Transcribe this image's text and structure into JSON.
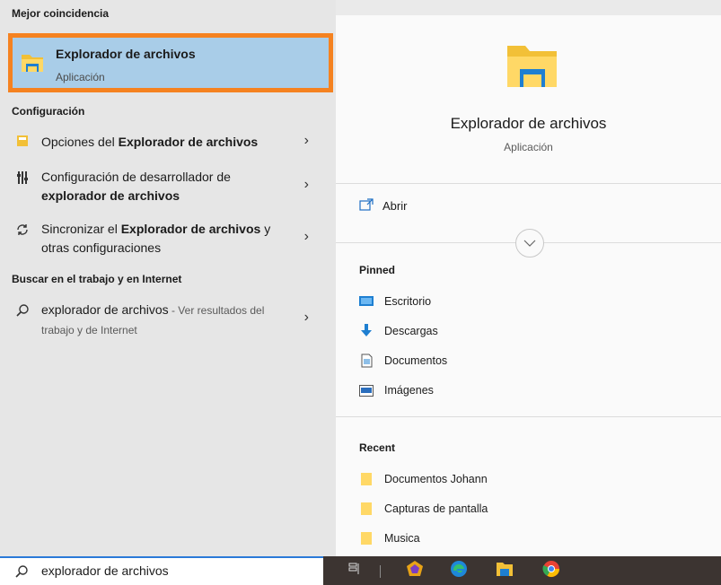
{
  "left": {
    "best_match_header": "Mejor coincidencia",
    "best_match": {
      "title": "Explorador de archivos",
      "subtitle": "Aplicación",
      "icon": "file-explorer-icon"
    },
    "settings_header": "Configuración",
    "settings": [
      {
        "icon": "settings-window-icon",
        "pre": "Opciones del ",
        "bold": "Explorador de archivos",
        "post": ""
      },
      {
        "icon": "developer-tools-icon",
        "pre": "Configuración de desarrollador de ",
        "bold": "explorador de archivos",
        "post": ""
      },
      {
        "icon": "sync-icon",
        "pre": "Sincronizar el ",
        "bold": "Explorador de archivos",
        "post": " y otras configuraciones"
      }
    ],
    "web_header": "Buscar en el trabajo y en Internet",
    "web_result": {
      "query": "explorador de archivos",
      "suffix": " - Ver resultados del trabajo y de Internet"
    }
  },
  "right": {
    "title": "Explorador de archivos",
    "subtitle": "Aplicación",
    "open_label": "Abrir",
    "pinned_header": "Pinned",
    "pinned": [
      "Escritorio",
      "Descargas",
      "Documentos",
      "Imágenes"
    ],
    "recent_header": "Recent",
    "recent": [
      "Documentos Johann",
      "Capturas de pantalla",
      "Musica"
    ]
  },
  "search": {
    "value": "explorador de archivos"
  },
  "colors": {
    "highlight": "#a9cde8",
    "focus_border": "#f58220",
    "accent": "#2b7ad8",
    "taskbar": "#3c3431"
  }
}
